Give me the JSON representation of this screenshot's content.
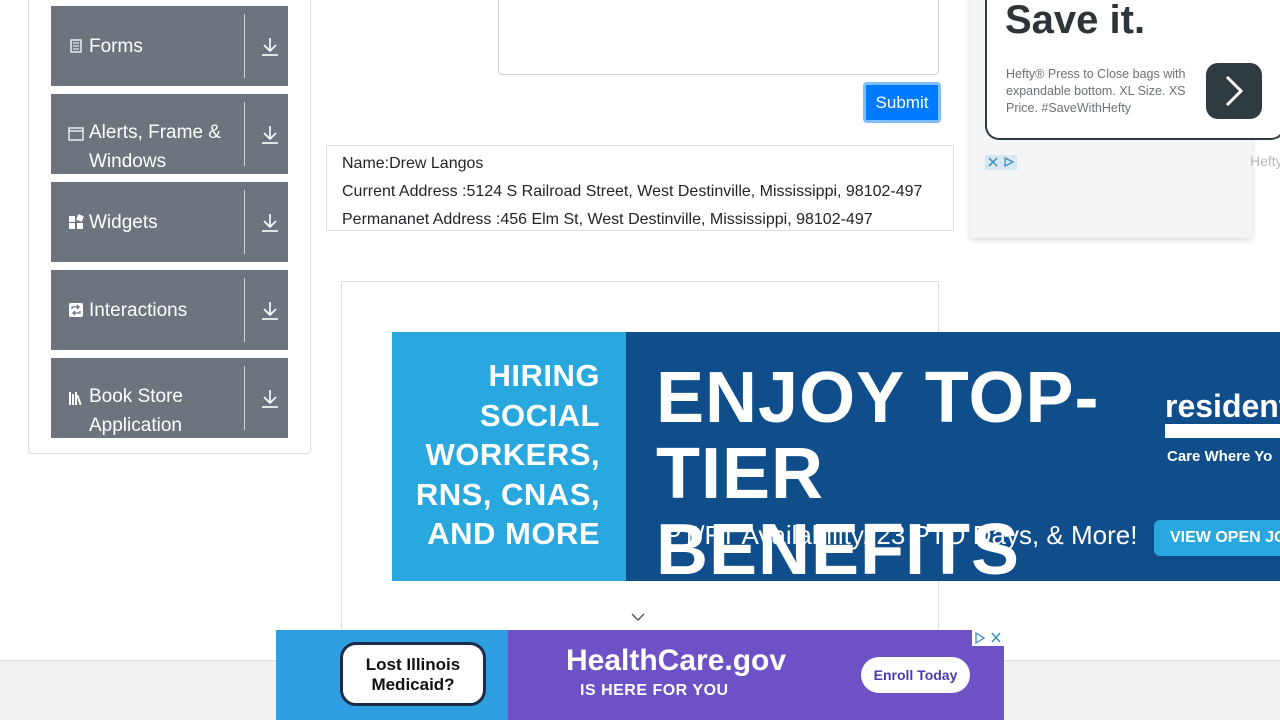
{
  "sidebar": {
    "groups": [
      {
        "label": "Forms",
        "icon": "form-icon"
      },
      {
        "label": "Alerts, Frame & Windows",
        "icon": "window-icon"
      },
      {
        "label": "Widgets",
        "icon": "widgets-icon"
      },
      {
        "label": "Interactions",
        "icon": "interactions-icon"
      },
      {
        "label": "Book Store Application",
        "icon": "books-icon"
      }
    ]
  },
  "form": {
    "submit_label": "Submit"
  },
  "output": {
    "name": "Name:Drew Langos",
    "current_address": "Current Address :5124 S Railroad Street, West Destinville, Mississippi, 98102-497",
    "permanent_address": "Permananet Address :456 Elm St, West Destinville, Mississippi, 98102-497"
  },
  "ads": {
    "right": {
      "headline": "Save it.",
      "copy": "Hefty® Press to Close bags with expandable bottom. XL Size. XS Price. #SaveWithHefty",
      "brand": "Hefty"
    },
    "banner": {
      "hiring": "HIRING SOCIAL WORKERS, RNS, CNAS, AND MORE",
      "headline": "ENJOY TOP-TIER BENEFITS",
      "sub": "PT/FT Availability, 23 PTO Days, & More!",
      "brand": "resident",
      "tagline": "Care Where Yo",
      "cta": "VIEW OPEN JO"
    },
    "bottom": {
      "bubble": "Lost Illinois Medicaid?",
      "title": "HealthCare.gov",
      "sub": "IS HERE FOR YOU",
      "button": "Enroll Today"
    }
  },
  "colors": {
    "sidebar_group": "#6c757d",
    "submit": "#007bff",
    "banner_dark": "#0f4e8a",
    "banner_light": "#29a8df",
    "bottom_ad": "#6d51c7"
  }
}
